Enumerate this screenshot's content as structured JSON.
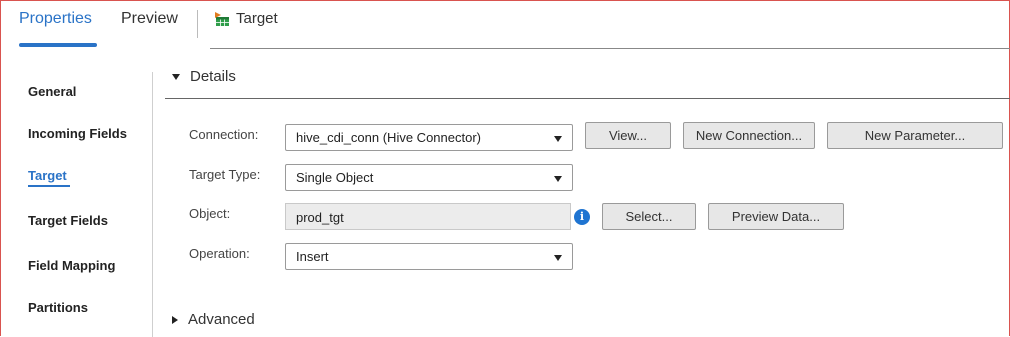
{
  "tabs": {
    "properties": "Properties",
    "preview": "Preview",
    "target_title": "Target",
    "accent": "#2a73c7"
  },
  "nav": {
    "items": [
      {
        "label": "General"
      },
      {
        "label": "Incoming Fields"
      },
      {
        "label": "Target"
      },
      {
        "label": "Target Fields"
      },
      {
        "label": "Field Mapping"
      },
      {
        "label": "Partitions"
      }
    ],
    "active": "Target"
  },
  "details": {
    "title": "Details",
    "connection_label": "Connection:",
    "connection_value": "hive_cdi_conn (Hive Connector)",
    "view_button": "View...",
    "new_connection_button": "New Connection...",
    "new_parameter_button": "New Parameter...",
    "target_type_label": "Target Type:",
    "target_type_value": "Single Object",
    "object_label": "Object:",
    "object_value": "prod_tgt",
    "info_icon": "i",
    "select_button": "Select...",
    "preview_data_button": "Preview Data...",
    "operation_label": "Operation:",
    "operation_value": "Insert"
  },
  "advanced": {
    "title": "Advanced"
  }
}
